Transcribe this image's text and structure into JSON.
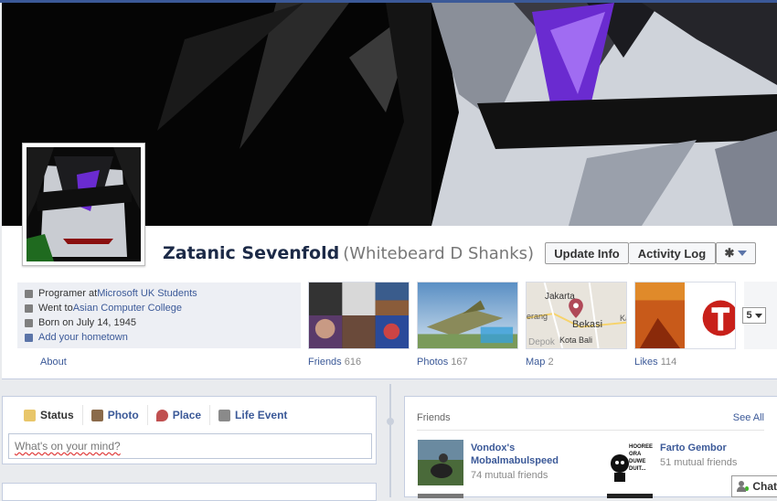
{
  "profile": {
    "name": "Zatanic Sevenfold",
    "alt_name": "(Whitebeard D Shanks)"
  },
  "actions": {
    "update_info": "Update Info",
    "activity_log": "Activity Log",
    "settings_icon": "gear-icon"
  },
  "about": {
    "items": [
      {
        "prefix": "Programer at ",
        "link": "Microsoft UK Students",
        "icon": "briefcase-icon"
      },
      {
        "prefix": "Went to ",
        "link": "Asian Computer College",
        "icon": "graduation-icon"
      },
      {
        "prefix": "Born on July 14, 1945",
        "link": "",
        "icon": "calendar-icon"
      },
      {
        "prefix": "",
        "link": "Add your hometown",
        "icon": "home-icon"
      }
    ],
    "tab_label": "About"
  },
  "apps": [
    {
      "label": "Friends",
      "count": "616"
    },
    {
      "label": "Photos",
      "count": "167"
    },
    {
      "label": "Map",
      "count": "2"
    },
    {
      "label": "Likes",
      "count": "114"
    }
  ],
  "map_labels": {
    "city1": "Jakarta",
    "city2": "Bekasi",
    "city3": "Kota Bali",
    "left1": "erang",
    "left2": "Depok",
    "right1": "Ka"
  },
  "more_apps": {
    "count": "5"
  },
  "composer": {
    "tabs": [
      {
        "label": "Status",
        "icon": "status-icon"
      },
      {
        "label": "Photo",
        "icon": "photo-icon"
      },
      {
        "label": "Place",
        "icon": "place-pin-icon"
      },
      {
        "label": "Life Event",
        "icon": "life-event-icon"
      }
    ],
    "placeholder": "What's on your mind?"
  },
  "friends_box": {
    "title": "Friends",
    "see_all": "See All",
    "friends": [
      {
        "name": "Vondox's Mobalmabulspeed",
        "mutual": "74 mutual friends"
      },
      {
        "name": "Farto Gembor",
        "mutual": "51 mutual friends"
      }
    ],
    "thumb_text": "HOOREE... ORA DUWE DUIT..."
  },
  "chat": {
    "label": "Chat"
  },
  "colors": {
    "brand": "#3b5998",
    "accent_purple": "#6a2bd0"
  }
}
